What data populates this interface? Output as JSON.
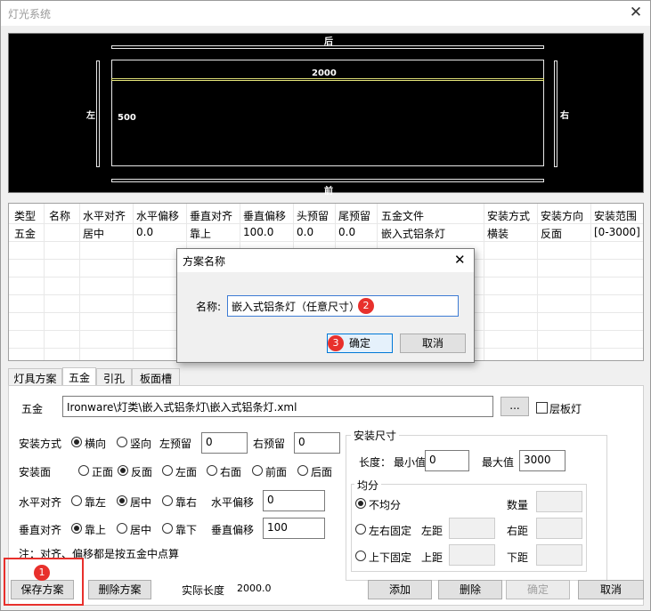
{
  "window": {
    "title": "灯光系统",
    "close_icon": "✕"
  },
  "canvas": {
    "label_back": "后",
    "label_front": "前",
    "label_left": "左",
    "label_right": "右",
    "length_value": "2000",
    "width_value": "500"
  },
  "grid": {
    "headers": [
      "类型",
      "名称",
      "水平对齐",
      "水平偏移",
      "垂直对齐",
      "垂直偏移",
      "头预留",
      "尾预留",
      "五金文件",
      "安装方式",
      "安装方向",
      "安装范围"
    ],
    "rows": [
      [
        "五金",
        "",
        "居中",
        "0.0",
        "靠上",
        "100.0",
        "0.0",
        "0.0",
        "嵌入式铝条灯",
        "横装",
        "反面",
        "[0-3000]"
      ]
    ]
  },
  "tabs": [
    "灯具方案",
    "五金",
    "引孔",
    "板面槽"
  ],
  "hardware": {
    "label": "五金",
    "path": "Ironware\\灯类\\嵌入式铝条灯\\嵌入式铝条灯.xml",
    "browse": "...",
    "layer_board": "层板灯"
  },
  "install_mode": {
    "label": "安装方式",
    "opt_h": "横向",
    "opt_v": "竖向",
    "left_reserve_label": "左预留",
    "left_reserve": "0",
    "right_reserve_label": "右预留",
    "right_reserve": "0"
  },
  "install_face": {
    "label": "安装面",
    "options": [
      "正面",
      "反面",
      "左面",
      "右面",
      "前面",
      "后面"
    ]
  },
  "h_align": {
    "label": "水平对齐",
    "options": [
      "靠左",
      "居中",
      "靠右"
    ],
    "offset_label": "水平偏移",
    "offset": "0"
  },
  "v_align": {
    "label": "垂直对齐",
    "options": [
      "靠上",
      "居中",
      "靠下"
    ],
    "offset_label": "垂直偏移",
    "offset": "100"
  },
  "note": "注：对齐、偏移都是按五金中点算",
  "size": {
    "title": "安装尺寸",
    "length_label": "长度：",
    "min_label": "最小值",
    "min": "0",
    "max_label": "最大值",
    "max": "3000"
  },
  "even": {
    "title": "均分",
    "uneven": "不均分",
    "count_label": "数量",
    "lr_fixed": "左右固定",
    "left_dist": "左距",
    "right_dist": "右距",
    "tb_fixed": "上下固定",
    "top_dist": "上距",
    "bottom_dist": "下距"
  },
  "footer": {
    "save": "保存方案",
    "delete_scheme": "删除方案",
    "actual_length_label": "实际长度",
    "actual_length": "2000.0",
    "add": "添加",
    "delete": "删除",
    "ok": "确定",
    "cancel": "取消"
  },
  "dialog": {
    "title": "方案名称",
    "close_icon": "✕",
    "name_label": "名称:",
    "name_value": "嵌入式铝条灯（任意尺寸）",
    "ok": "确定",
    "cancel": "取消"
  },
  "badges": [
    "1",
    "2",
    "3"
  ],
  "colors": {
    "badge": "#e8302c",
    "canvas_bg": "#000000"
  }
}
